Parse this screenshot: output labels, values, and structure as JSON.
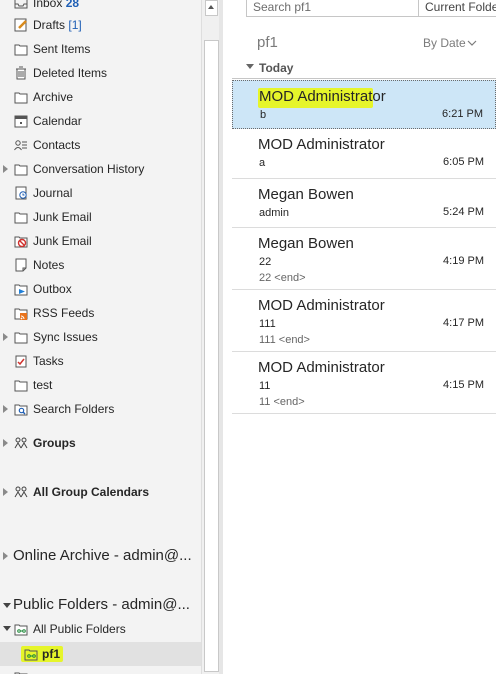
{
  "folders": [
    {
      "label": "Inbox",
      "count": "28",
      "icon": "inbox-icon"
    },
    {
      "label": "Drafts",
      "count": "[1]",
      "icon": "drafts-icon"
    },
    {
      "label": "Sent Items",
      "icon": "folder-icon"
    },
    {
      "label": "Deleted Items",
      "icon": "trash-icon"
    },
    {
      "label": "Archive",
      "icon": "folder-icon"
    },
    {
      "label": "Calendar",
      "icon": "calendar-icon"
    },
    {
      "label": "Contacts",
      "icon": "contacts-icon"
    },
    {
      "label": "Conversation History",
      "icon": "folder-icon"
    },
    {
      "label": "Journal",
      "icon": "journal-icon"
    },
    {
      "label": "Junk Email",
      "icon": "folder-icon"
    },
    {
      "label": "Junk Email",
      "icon": "junk-icon"
    },
    {
      "label": "Notes",
      "icon": "notes-icon"
    },
    {
      "label": "Outbox",
      "icon": "outbox-icon"
    },
    {
      "label": "RSS Feeds",
      "icon": "rss-icon"
    },
    {
      "label": "Sync Issues",
      "icon": "folder-icon"
    },
    {
      "label": "Tasks",
      "icon": "tasks-icon"
    },
    {
      "label": "test",
      "icon": "folder-icon"
    },
    {
      "label": "Search Folders",
      "icon": "search-folder-icon"
    }
  ],
  "groups": {
    "label": "Groups",
    "icon": "groups-icon"
  },
  "group_calendars": {
    "label": "All Group Calendars",
    "icon": "groups-icon"
  },
  "online_archive": {
    "label": "Online Archive - admin@..."
  },
  "public_folders": {
    "label": "Public Folders - admin@...",
    "all_public": "All Public Folders",
    "selected_folder": "pf1"
  },
  "search": {
    "placeholder": "Search pf1",
    "scope": "Current Folder"
  },
  "list": {
    "title": "pf1",
    "sort_label": "By Date",
    "group_header": "Today",
    "messages": [
      {
        "sender": "MOD Administrator",
        "subject": "b",
        "preview": "",
        "time": "6:21 PM",
        "selected": true
      },
      {
        "sender": "MOD Administrator",
        "subject": "a",
        "preview": "",
        "time": "6:05 PM"
      },
      {
        "sender": "Megan Bowen",
        "subject": "admin",
        "preview": "",
        "time": "5:24 PM"
      },
      {
        "sender": "Megan Bowen",
        "subject": "22",
        "preview": "22 <end>",
        "time": "4:19 PM"
      },
      {
        "sender": "MOD Administrator",
        "subject": "111",
        "preview": "111 <end>",
        "time": "4:17 PM"
      },
      {
        "sender": "MOD Administrator",
        "subject": "11",
        "preview": "11 <end>",
        "time": "4:15 PM"
      }
    ]
  },
  "colors": {
    "highlight": "#e6f52a",
    "selected_bg": "#cde6f7",
    "link_blue": "#1f5fb5"
  }
}
